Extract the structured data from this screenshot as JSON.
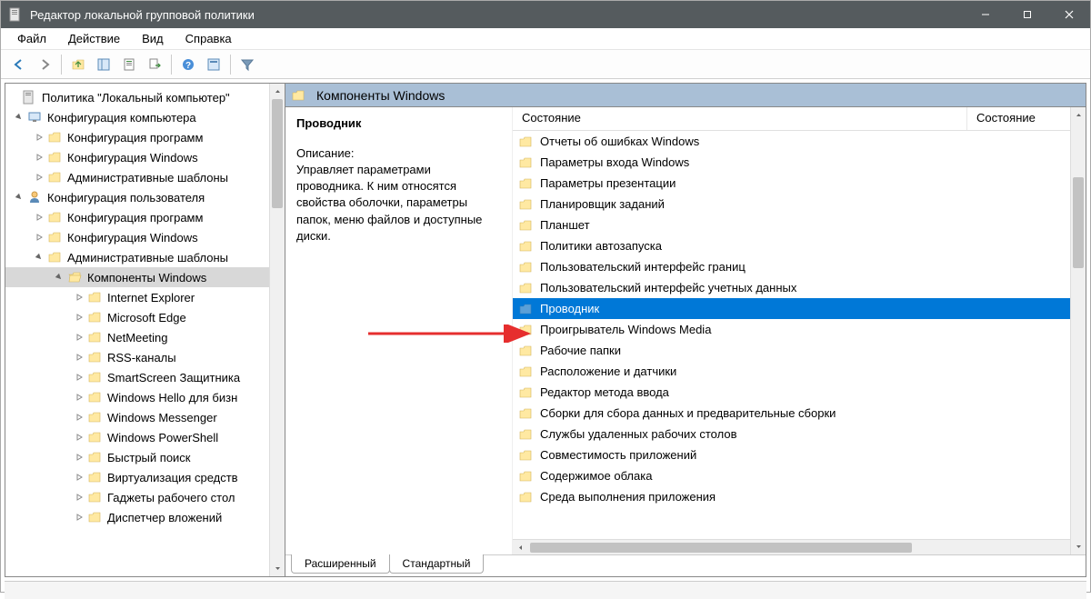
{
  "window": {
    "title": "Редактор локальной групповой политики"
  },
  "menu": {
    "file": "Файл",
    "action": "Действие",
    "view": "Вид",
    "help": "Справка"
  },
  "tree": {
    "root": "Политика \"Локальный компьютер\"",
    "comp_conf": "Конфигурация компьютера",
    "comp_soft": "Конфигурация программ",
    "comp_win": "Конфигурация Windows",
    "comp_admin": "Административные шаблоны",
    "user_conf": "Конфигурация пользователя",
    "user_soft": "Конфигурация программ",
    "user_win": "Конфигурация Windows",
    "user_admin": "Административные шаблоны",
    "win_components": "Компоненты Windows",
    "items": [
      "Internet Explorer",
      "Microsoft Edge",
      "NetMeeting",
      "RSS-каналы",
      "SmartScreen Защитника",
      "Windows Hello для бизн",
      "Windows Messenger",
      "Windows PowerShell",
      "Быстрый поиск",
      "Виртуализация средств",
      "Гаджеты рабочего стол",
      "Диспетчер вложений"
    ]
  },
  "header": {
    "label": "Компоненты Windows"
  },
  "desc": {
    "title": "Проводник",
    "label": "Описание:",
    "text": "Управляет параметрами проводника. К ним относятся свойства оболочки, параметры папок, меню файлов и доступные диски."
  },
  "columns": {
    "c1": "Состояние",
    "c2": "Состояние"
  },
  "listitems": [
    {
      "label": "Отчеты об ошибках Windows",
      "sel": false
    },
    {
      "label": "Параметры входа Windows",
      "sel": false
    },
    {
      "label": "Параметры презентации",
      "sel": false
    },
    {
      "label": "Планировщик заданий",
      "sel": false
    },
    {
      "label": "Планшет",
      "sel": false
    },
    {
      "label": "Политики автозапуска",
      "sel": false
    },
    {
      "label": "Пользовательский интерфейс границ",
      "sel": false
    },
    {
      "label": "Пользовательский интерфейс учетных данных",
      "sel": false
    },
    {
      "label": "Проводник",
      "sel": true
    },
    {
      "label": "Проигрыватель Windows Media",
      "sel": false
    },
    {
      "label": "Рабочие папки",
      "sel": false
    },
    {
      "label": "Расположение и датчики",
      "sel": false
    },
    {
      "label": "Редактор метода ввода",
      "sel": false
    },
    {
      "label": "Сборки для сбора данных и предварительные сборки",
      "sel": false
    },
    {
      "label": "Службы удаленных рабочих столов",
      "sel": false
    },
    {
      "label": "Совместимость приложений",
      "sel": false
    },
    {
      "label": "Содержимое облака",
      "sel": false
    },
    {
      "label": "Среда выполнения приложения",
      "sel": false
    }
  ],
  "tabs": {
    "extended": "Расширенный",
    "standard": "Стандартный"
  }
}
